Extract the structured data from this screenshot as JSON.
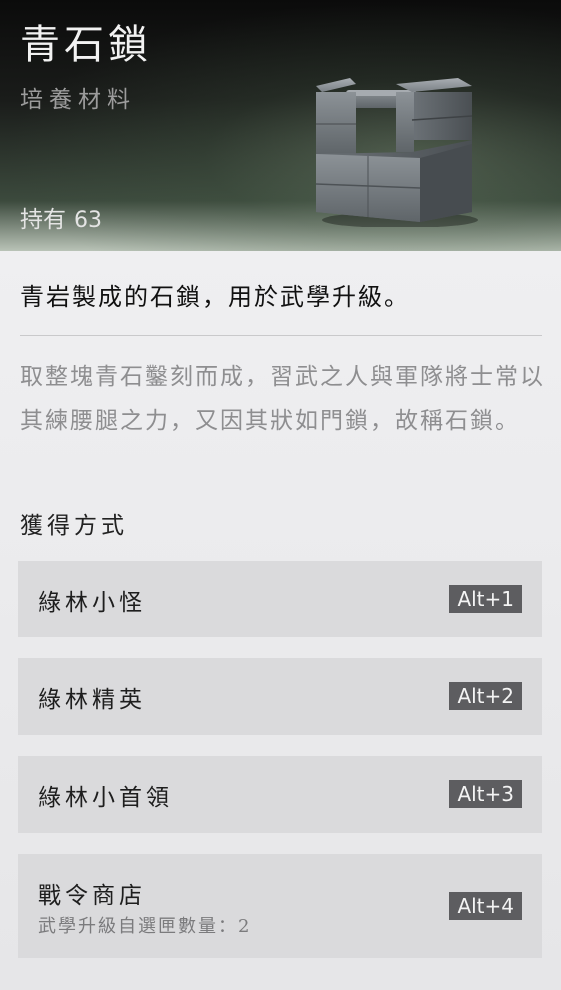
{
  "item": {
    "name": "青石鎖",
    "category": "培養材料",
    "owned_label": "持有",
    "owned_count": "63",
    "image_icon": "stone-lock-icon"
  },
  "description": {
    "summary": "青岩製成的石鎖，用於武學升級。",
    "lore": "取整塊青石鑿刻而成，習武之人與軍隊將士常以其練腰腿之力，又因其狀如門鎖，故稱石鎖。"
  },
  "acquisition": {
    "heading": "獲得方式",
    "sources": [
      {
        "label": "綠林小怪",
        "hotkey": "Alt+1",
        "note": ""
      },
      {
        "label": "綠林精英",
        "hotkey": "Alt+2",
        "note": ""
      },
      {
        "label": "綠林小首領",
        "hotkey": "Alt+3",
        "note": ""
      },
      {
        "label": "戰令商店",
        "hotkey": "Alt+4",
        "note": "武學升級自選匣數量：2"
      }
    ]
  },
  "colors": {
    "header_dark": "#0b0b0b",
    "body_bg": "#e7e7e9",
    "source_bg": "#dadadc",
    "hotkey_bg": "#5d5d60"
  }
}
